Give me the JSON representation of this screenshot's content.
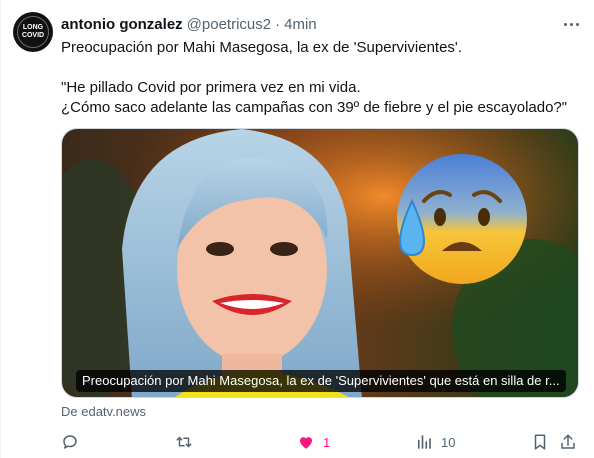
{
  "author": {
    "name": "antonio gonzalez",
    "handle": "@poetricus2",
    "separator": "·",
    "time": "4min",
    "avatar_text_top": "LONG",
    "avatar_text_bottom": "COVID"
  },
  "tweet": {
    "line1": "Preocupación por Mahi Masegosa, la ex de 'Supervivientes'.",
    "line2": "\"He pillado Covid por primera vez en mi vida.",
    "line3": "¿Cómo saco adelante las campañas con 39º de fiebre y el pie escayolado?\""
  },
  "card": {
    "caption": "Preocupación por Mahi Masegosa, la ex de 'Supervivientes' que está en silla de r...",
    "source": "De edatv.news"
  },
  "actions": {
    "likes": "1",
    "views": "10"
  },
  "colors": {
    "text": "#0f1419",
    "muted": "#536471",
    "like_pink": "#f91880",
    "border": "#cfd9de"
  },
  "icons": [
    "more-icon",
    "reply-icon",
    "retweet-icon",
    "heart-icon",
    "views-icon",
    "bookmark-icon",
    "share-icon"
  ]
}
